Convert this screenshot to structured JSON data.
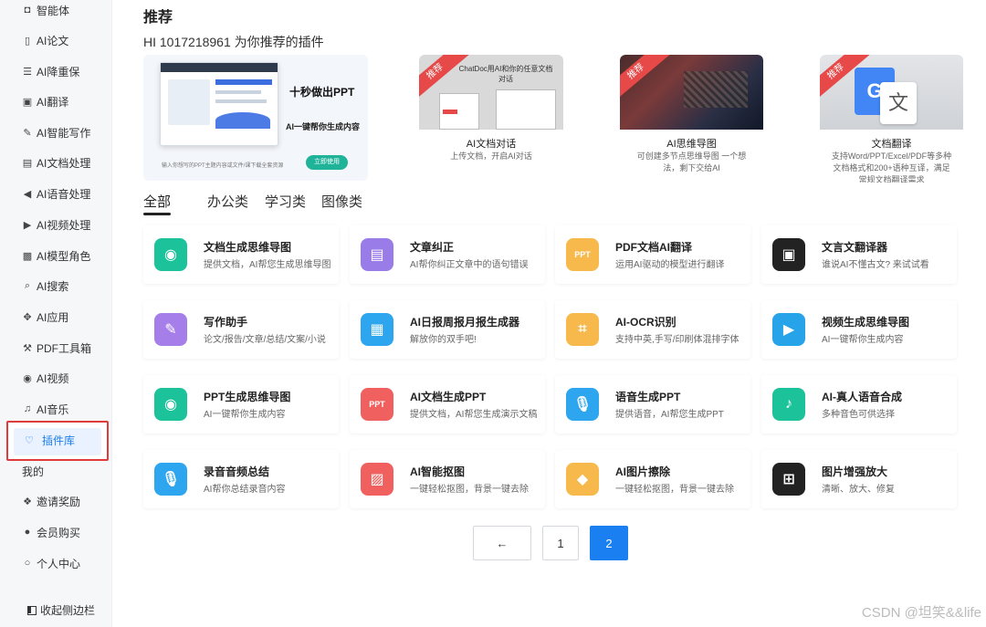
{
  "sidebar": {
    "items": [
      {
        "label": "智能体",
        "icon": "robot-icon"
      },
      {
        "label": "AI论文",
        "icon": "document-icon"
      },
      {
        "label": "AI降重保",
        "icon": "list-icon"
      },
      {
        "label": "AI翻译",
        "icon": "translate-icon"
      },
      {
        "label": "AI智能写作",
        "icon": "pen-icon"
      },
      {
        "label": "AI文档处理",
        "icon": "text-doc-icon"
      },
      {
        "label": "AI语音处理",
        "icon": "speaker-icon"
      },
      {
        "label": "AI视频处理",
        "icon": "video-icon"
      },
      {
        "label": "AI模型角色",
        "icon": "cube-icon"
      },
      {
        "label": "AI搜索",
        "icon": "search-icon"
      },
      {
        "label": "AI应用",
        "icon": "apps-icon"
      },
      {
        "label": "PDF工具箱",
        "icon": "wrench-icon"
      },
      {
        "label": "AI视频",
        "icon": "play-circle-icon"
      },
      {
        "label": "AI音乐",
        "icon": "music-icon"
      }
    ],
    "active_label": "插件库",
    "active_icon": "bulb-icon",
    "section_label": "我的",
    "bottom_items": [
      {
        "label": "邀请奖励",
        "icon": "gift-icon"
      },
      {
        "label": "会员购买",
        "icon": "user-icon"
      },
      {
        "label": "个人中心",
        "icon": "person-outline-icon"
      }
    ],
    "collapse_label": "收起侧边栏"
  },
  "main": {
    "title": "推荐",
    "subtitle": "HI 1017218961 为你推荐的插件",
    "hero": {
      "headline": "十秒做出PPT",
      "sub": "AI一键帮你生成内容",
      "caption": "输入你想写的PPT主题内容或文件/课下载全套资源",
      "button": "立即使用"
    },
    "banners": [
      {
        "badge": "推荐",
        "title": "AI文档对话",
        "desc": "上传文档，开启AI对话",
        "img_text": "ChatDoc用AI和你的任意文档对话"
      },
      {
        "badge": "推荐",
        "title": "AI思维导图",
        "desc": "可创建多节点思维导图 一个想法，剩下交给AI"
      },
      {
        "badge": "推荐",
        "title": "文档翻译",
        "desc": "支持Word/PPT/Excel/PDF等多种文档格式和200+语种互译，满足常规文档翻译需求",
        "img_text": "G 文"
      }
    ],
    "tabs": [
      "全部",
      "办公类",
      "学习类",
      "图像类"
    ],
    "cards": [
      {
        "title": "文档生成思维导图",
        "desc": "提供文档，AI帮您生成思维导图",
        "color": "#1cc39a",
        "glyph": "◉"
      },
      {
        "title": "文章纠正",
        "desc": "AI帮你纠正文章中的语句错误",
        "color": "#9a7ce8",
        "glyph": "▤"
      },
      {
        "title": "PDF文档AI翻译",
        "desc": "运用AI驱动的模型进行翻译",
        "color": "#f7b94c",
        "glyph": "PPT"
      },
      {
        "title": "文言文翻译器",
        "desc": "谁说AI不懂古文? 来试试看",
        "color": "#222222",
        "glyph": "▣"
      },
      {
        "title": "写作助手",
        "desc": "论文/报告/文章/总结/文案/小说",
        "color": "#a67ee9",
        "glyph": "✎"
      },
      {
        "title": "AI日报周报月报生成器",
        "desc": "解放你的双手吧!",
        "color": "#2ea6ef",
        "glyph": "▦"
      },
      {
        "title": "AI-OCR识别",
        "desc": "支持中英,手写/印刷体混排字体",
        "color": "#f7b94c",
        "glyph": "⌗"
      },
      {
        "title": "视频生成思维导图",
        "desc": "AI一键帮你生成内容",
        "color": "#27a3ea",
        "glyph": "▶"
      },
      {
        "title": "PPT生成思维导图",
        "desc": "AI一键帮你生成内容",
        "color": "#1cc39a",
        "glyph": "◉"
      },
      {
        "title": "AI文档生成PPT",
        "desc": "提供文档，AI帮您生成演示文稿",
        "color": "#f0605e",
        "glyph": "PPT"
      },
      {
        "title": "语音生成PPT",
        "desc": "提供语音，AI帮您生成PPT",
        "color": "#2ea6ef",
        "glyph": "🎙"
      },
      {
        "title": "AI-真人语音合成",
        "desc": "多种音色可供选择",
        "color": "#1cc39a",
        "glyph": "♪"
      },
      {
        "title": "录音音频总结",
        "desc": "AI帮你总结录音内容",
        "color": "#2ea6ef",
        "glyph": "🎙"
      },
      {
        "title": "AI智能抠图",
        "desc": "一键轻松抠图，背景一键去除",
        "color": "#f0605e",
        "glyph": "▨"
      },
      {
        "title": "AI图片擦除",
        "desc": "一键轻松抠图，背景一键去除",
        "color": "#f7b94c",
        "glyph": "◆"
      },
      {
        "title": "图片增强放大",
        "desc": "清晰、放大、修复",
        "color": "#222222",
        "glyph": "⊞"
      }
    ],
    "pager": {
      "prev": "←",
      "pages": [
        "1",
        "2"
      ],
      "current": "2"
    }
  },
  "watermark": "CSDN @坦笑&&life"
}
